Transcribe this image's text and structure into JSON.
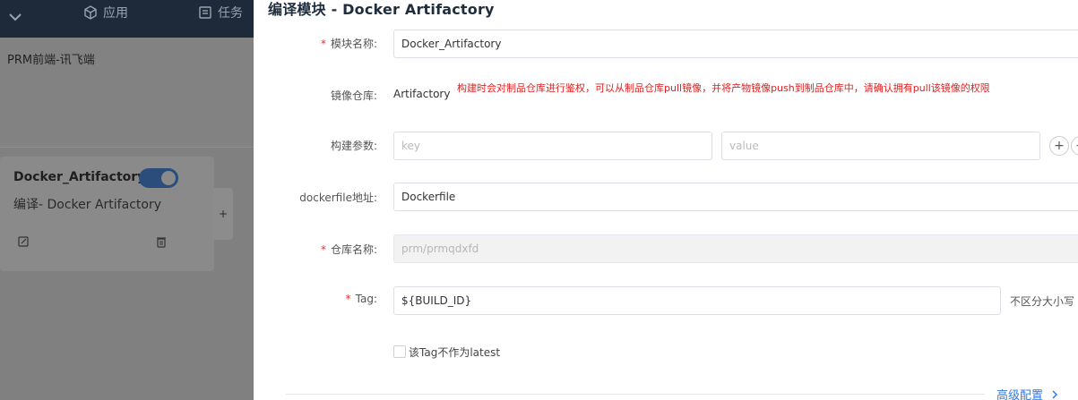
{
  "background_app": {
    "nav": [
      {
        "label": "应用",
        "icon": "cube-icon"
      },
      {
        "label": "任务",
        "icon": "task-icon"
      }
    ],
    "project_name": "PRM前端-讯飞端",
    "module_card": {
      "title": "Docker_Artifactory",
      "subtitle": "编译- Docker Artifactory",
      "enabled": true,
      "add_label": "+"
    }
  },
  "drawer": {
    "title": "编译模块 - Docker Artifactory",
    "fields": {
      "module_name": {
        "label": "模块名称:",
        "value": "Docker_Artifactory",
        "required": true
      },
      "image_repo": {
        "label": "镜像仓库:",
        "value": "Artifactory",
        "note": "构建时会对制品仓库进行鉴权，可以从制品仓库pull镜像，并将产物镜像push到制品仓库中，请确认拥有pull该镜像的权限"
      },
      "build_args": {
        "label": "构建参数:",
        "key_placeholder": "key",
        "value_placeholder": "value",
        "add_label": "+"
      },
      "dockerfile": {
        "label": "dockerfile地址:",
        "value": "Dockerfile"
      },
      "repo_name": {
        "label": "仓库名称:",
        "value": "prm/prmqdxfd",
        "required": true,
        "disabled": true
      },
      "tag": {
        "label": "Tag:",
        "value": "${BUILD_ID}",
        "suffix": "不区分大小写",
        "required": true
      },
      "not_latest": {
        "label": "该Tag不作为latest",
        "checked": false
      }
    },
    "advanced_label": "高级配置",
    "colors": {
      "required": "#e0322f",
      "link": "#2d7be5",
      "warning": "#e02020"
    }
  }
}
